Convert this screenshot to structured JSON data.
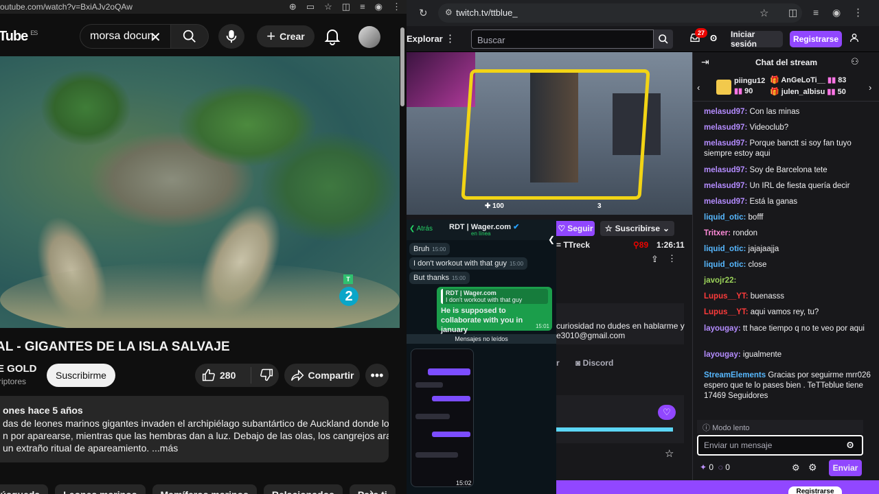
{
  "youtube": {
    "url": "outube.com/watch?v=BxiAJv2oQAw",
    "logo": "Tube",
    "logo_region": "ES",
    "search_value": "morsa docun",
    "create_label": "Crear",
    "video_badge": "2",
    "title": "AL - GIGANTES DE LA ISLA SALVAJE",
    "channel": "E GOLD",
    "subs": "riptores",
    "subscribe_label": "Suscribirme",
    "likes": "280",
    "share_label": "Compartir",
    "desc_meta": "ones  hace 5 años",
    "desc_line1": "das de leones marinos gigantes invaden el archipiélago subantártico de Auckland donde los",
    "desc_line2": "n por aparearse, mientras que las hembras dan a luz. Debajo de las olas, los cangrejos araña",
    "desc_line3": "un extraño ritual de apareamiento. ...más",
    "chips": [
      "búsqueda",
      "Leones marinos",
      "Mamíferos marinos",
      "Relacionados",
      "Para ti"
    ]
  },
  "twitch": {
    "url": "twitch.tv/ttblue_",
    "explore": "Explorar",
    "search_placeholder": "Buscar",
    "notif_count": "27",
    "login": "Iniciar sesión",
    "signup": "Registrarse",
    "follow": "Seguir",
    "subscribe": "Suscribirse",
    "streamer": "= TTreck",
    "viewers": "89",
    "uptime": "1:26:11",
    "about1": "curiosidad no dudes en hablarme y",
    "about2": "e3010@gmail.com",
    "discord": "Discord",
    "about_partial": "r",
    "hud_hp": "100",
    "hud_ammo": "3",
    "chat": {
      "title": "Chat del stream",
      "gifter1": "piingu12",
      "gifter1_count": "90",
      "gifter2": "AnGeLoTi__",
      "gifter2_count": "83",
      "gifter3": "julen_albisu",
      "gifter3_count": "50",
      "messages": [
        {
          "user": "melasud97:",
          "text": " Con las minas",
          "color": "#b48cff"
        },
        {
          "user": "melasud97:",
          "text": " Videoclub?",
          "color": "#b48cff"
        },
        {
          "user": "melasud97:",
          "text": " Porque banctt si soy fan tuyo siempre estoy aqui",
          "color": "#b48cff"
        },
        {
          "user": "melasud97:",
          "text": " Soy de Barcelona tete",
          "color": "#b48cff"
        },
        {
          "user": "melasud97:",
          "text": " Un IRL de fiesta quería decir",
          "color": "#b48cff"
        },
        {
          "user": "melasud97:",
          "text": " Está la ganas",
          "color": "#b48cff"
        },
        {
          "user": "liquid_otic:",
          "text": " bofff",
          "color": "#57b8ff"
        },
        {
          "user": "Tritxer:",
          "text": " rondon",
          "color": "#ff8ad8"
        },
        {
          "user": "liquid_otic:",
          "text": " jajajaajja",
          "color": "#57b8ff"
        },
        {
          "user": "liquid_otic:",
          "text": " close",
          "color": "#57b8ff"
        },
        {
          "user": "javojr22:",
          "text": "",
          "color": "#9bd35a"
        },
        {
          "user": "Lupus__YT:",
          "text": " buenasss",
          "color": "#ff3b3b"
        },
        {
          "user": "Lupus__YT:",
          "text": " aqui vamos rey, tu?",
          "color": "#ff3b3b"
        },
        {
          "user": "layougay:",
          "text": " tt hace tiempo q no te veo por aqui",
          "color": "#b48cff"
        },
        {
          "user": "layougay:",
          "text": " igualmente",
          "color": "#b48cff"
        },
        {
          "user": "StreamElements",
          "text": " Gracias por seguirme mrr026 espero que te lo pases bien . TeTTeblue tiene 17469 Seguidores",
          "color": "#57b8ff"
        }
      ],
      "slow_mode": "Modo lento",
      "input_placeholder": "Enviar un mensaje",
      "points1": "0",
      "points2": "0",
      "send": "Enviar",
      "register_bottom": "Registrarse"
    },
    "whatsapp": {
      "back": "Atrás",
      "contact": "RDT | Wager.com",
      "status": "en línea",
      "m1": "Bruh",
      "m1t": "15:00",
      "m2": "I don't workout with that guy",
      "m2t": "15:00",
      "m3": "But thanks",
      "m3t": "15:00",
      "reply_name": "RDT | Wager.com",
      "reply_quote": "I don't workout with that guy",
      "reply_text": "He is supposed to collaborate with you in january",
      "reply_t": "15:01",
      "unread": "Mensajes no leídos",
      "shot_time": "15:02"
    }
  }
}
